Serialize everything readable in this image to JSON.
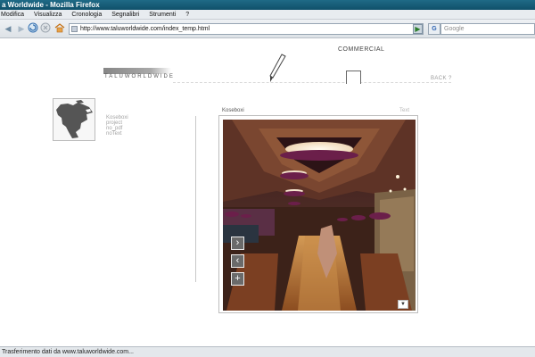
{
  "window": {
    "title": "a Worldwide - Mozilla Firefox"
  },
  "menu": {
    "items": [
      "Modifica",
      "Visualizza",
      "Cronologia",
      "Segnalibri",
      "Strumenti",
      "?"
    ]
  },
  "navbar": {
    "address": "http://www.taluworldwide.com/index_temp.html",
    "search_placeholder": "Google",
    "search_engine": "G"
  },
  "site": {
    "logo_text": "TALUWORLDWIDE",
    "category": "COMMERCIAL",
    "back_label": "BACK ?",
    "project_info": [
      "Koseboxi",
      "project",
      "no_pdf",
      "noText"
    ],
    "image": {
      "title": "Koseboxi",
      "text_label": "Text"
    },
    "controls": {
      "next": "›",
      "prev": "‹",
      "zoom": "+"
    },
    "scroll_indicator": "▼"
  },
  "status": {
    "text": "Trasferimento dati da www.taluworldwide.com..."
  }
}
